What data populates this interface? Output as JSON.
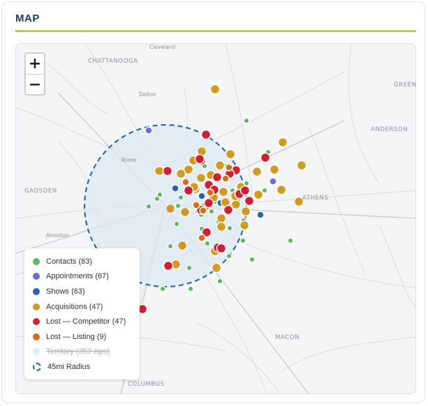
{
  "panel": {
    "title": "MAP"
  },
  "zoom": {
    "in_label": "+",
    "out_label": "−"
  },
  "cities": [
    {
      "name": "Cleveland"
    },
    {
      "name": "CHATTANOOGA"
    },
    {
      "name": "GREEN"
    },
    {
      "name": "Dalton"
    },
    {
      "name": "ANDERSON"
    },
    {
      "name": "Rome"
    },
    {
      "name": "GADSDEN"
    },
    {
      "name": "ATHENS"
    },
    {
      "name": "Anniston"
    },
    {
      "name": "MACON"
    },
    {
      "name": "COLUMBUS"
    }
  ],
  "colors": {
    "contacts": "#5cb85c",
    "appointments": "#6a6ee0",
    "shows": "#2c63ab",
    "acquisitions": "#d19a20",
    "lost_competitor": "#cf1f33",
    "lost_listing": "#d96c1b",
    "territory": "#e3edf6",
    "radius": "#1c5ea6"
  },
  "legend": [
    {
      "label": "Contacts (83)",
      "color": "#5cb85c",
      "key": "contacts"
    },
    {
      "label": "Appointments (67)",
      "color": "#6a6ee0",
      "key": "appointments"
    },
    {
      "label": "Shows (63)",
      "color": "#2c63ab",
      "key": "shows"
    },
    {
      "label": "Acquisitions (47)",
      "color": "#d19a20",
      "key": "acquisitions"
    },
    {
      "label": "Lost — Competitor (47)",
      "color": "#cf1f33",
      "key": "lost_competitor"
    },
    {
      "label": "Lost — Listing (9)",
      "color": "#d96c1b",
      "key": "lost_listing"
    },
    {
      "label": "Territory (353 zips)",
      "color": "#e3edf6",
      "key": "territory",
      "disabled": true
    },
    {
      "label": "45mi Radius",
      "color": "#1c5ea6",
      "key": "radius",
      "ring": true
    }
  ]
}
